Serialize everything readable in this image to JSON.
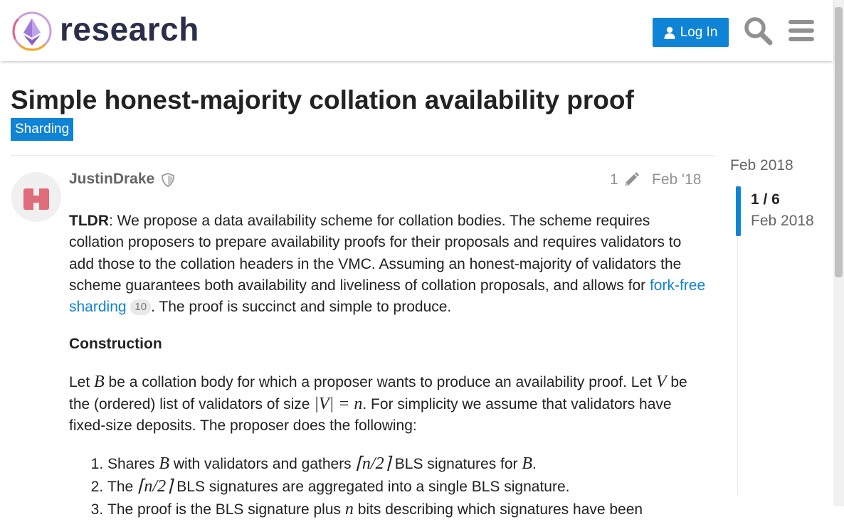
{
  "header": {
    "logo_text": "research",
    "login_label": "Log In"
  },
  "topic": {
    "title": "Simple honest-majority collation availability proof",
    "category": "Sharding"
  },
  "post": {
    "username": "JustinDrake",
    "edit_count": "1",
    "date": "Feb '18",
    "p1_strong": "TLDR",
    "p1_text": ": We propose a data availability scheme for collation bodies. The scheme requires collation proposers to prepare availability proofs for their proposals and requires validators to add those to the collation headers in the VMC. Assuming an honest-majority of validators the scheme guarantees both availability and liveliness of collation proposals, and allows for ",
    "p1_link": "fork-free sharding",
    "p1_link_clicks": "10",
    "p1_end": ". The proof is succinct and simple to produce.",
    "h_construction": "Construction",
    "p2_a": "Let ",
    "p2_B": "B",
    "p2_b": " be a collation body for which a proposer wants to produce an availability proof. Let ",
    "p2_V": "V",
    "p2_c": " be the (ordered) list of validators of size ",
    "p2_math": "|V| = n",
    "p2_d": ". For simplicity we assume that validators have fixed-size deposits. The proposer does the following:",
    "list": [
      {
        "a": "Shares ",
        "m1": "B",
        "b": " with validators and gathers ",
        "m2": "⌈n/2⌉",
        "c": " BLS signatures for ",
        "m3": "B",
        "d": "."
      },
      {
        "a": "The ",
        "m1": "⌈n/2⌉",
        "b": " BLS signatures are aggregated into a single BLS signature."
      },
      {
        "a": "The proof is the BLS signature plus ",
        "m1": "n",
        "b": " bits describing which signatures have been"
      }
    ]
  },
  "timeline": {
    "top_date": "Feb 2018",
    "position": "1 / 6",
    "current_date": "Feb 2018"
  },
  "colors": {
    "accent": "#0f83d6",
    "avatar": "#e06b7a"
  }
}
